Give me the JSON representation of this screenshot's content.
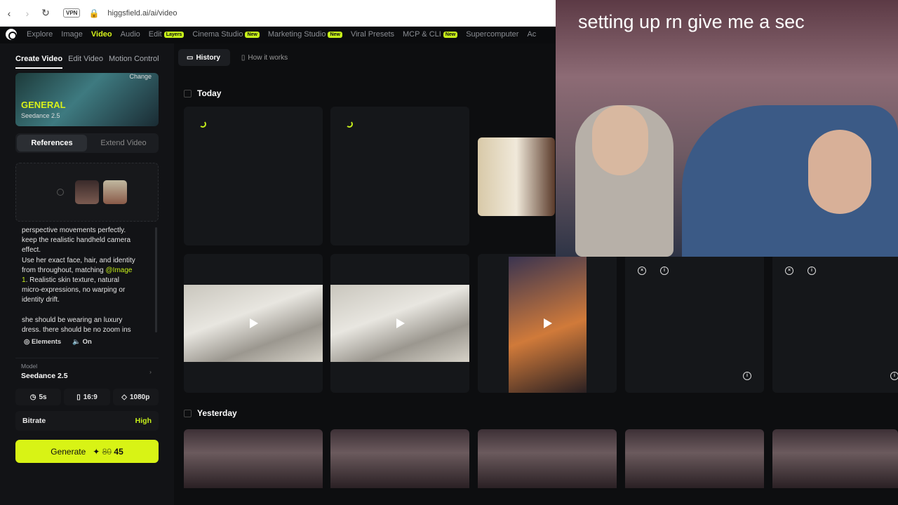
{
  "browser": {
    "url": "higgsfield.ai/ai/video",
    "vpn": "VPN"
  },
  "nav": {
    "items": [
      "Explore",
      "Image",
      "Video",
      "Audio",
      "Edit",
      "Cinema Studio",
      "Marketing Studio",
      "Viral Presets",
      "MCP & CLI",
      "Supercomputer",
      "Ac"
    ],
    "badges": {
      "edit": "Layers",
      "new": "New"
    }
  },
  "sidebar": {
    "tabs": [
      "Create Video",
      "Edit Video",
      "Motion Control"
    ],
    "preset": {
      "change": "Change",
      "name": "GENERAL",
      "model": "Seedance 2.5"
    },
    "ref_tabs": [
      "References",
      "Extend Video"
    ],
    "prompt": {
      "l1": "perspective movements perfectly.",
      "l2": "keep the realistic handheld camera",
      "l3": "effect.",
      "l4": "Use her exact face, hair, and identity",
      "l5a": "from throughout, matching ",
      "mention": "@Image",
      "l6a": "1",
      "l6b": ". Realistic skin texture, natural",
      "l7": "micro-expressions, no warping or",
      "l8": "identity drift.",
      "l9": "she should be wearing an luxury",
      "l10": "dress. there should be no zoom ins"
    },
    "elements": "Elements",
    "audio": "On",
    "model_label": "Model",
    "model_value": "Seedance 2.5",
    "duration": "5s",
    "ratio": "16:9",
    "resolution": "1080p",
    "bitrate_label": "Bitrate",
    "bitrate_value": "High",
    "generate": {
      "label": "Generate",
      "old": "80",
      "new": "45"
    }
  },
  "main": {
    "tabs": [
      "History",
      "How it works"
    ],
    "today": "Today",
    "yesterday": "Yesterday"
  },
  "overlay": {
    "caption": "setting up rn give me a sec"
  }
}
